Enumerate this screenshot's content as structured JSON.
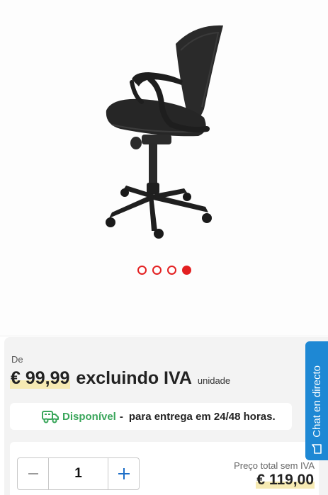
{
  "gallery": {
    "image": "office-chair-product-photo",
    "dots": [
      false,
      false,
      false,
      true
    ]
  },
  "product": {
    "from_label": "De",
    "price": "€ 99,99",
    "price_suffix": "excluindo IVA",
    "unit": "unidade"
  },
  "availability": {
    "icon": "truck-icon",
    "status": "Disponível",
    "separator": "-",
    "text": "para entrega em 24/48 horas."
  },
  "quantity": {
    "value": "1",
    "total_label": "Preço total sem IVA",
    "total_value": "€ 119,00"
  },
  "chat": {
    "label": "Chat en directo",
    "icon": "chat-bubble-icon"
  },
  "colors": {
    "accent_red": "#e32021",
    "available_green": "#3aa65b",
    "chat_blue": "#1e88d4",
    "price_highlight": "#f6eab3"
  }
}
